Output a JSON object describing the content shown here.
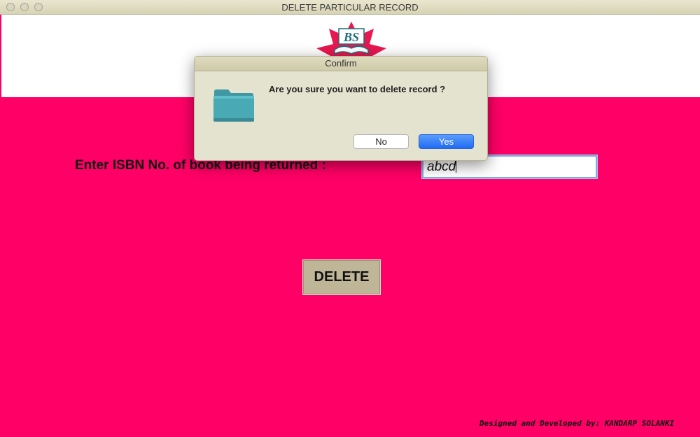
{
  "window": {
    "title": "DELETE PARTICULAR RECORD"
  },
  "header": {
    "logo_text": "BS"
  },
  "form": {
    "isbn_label": "Enter ISBN No. of book being returned :",
    "isbn_value": "abcd",
    "delete_label": "DELETE"
  },
  "footer": {
    "credit": "Designed and Developed by: KANDARP SOLANKI"
  },
  "dialog": {
    "title": "Confirm",
    "message": "Are you sure you want to delete record ?",
    "icon": "folder-icon",
    "no_label": "No",
    "yes_label": "Yes"
  },
  "colors": {
    "background": "#ff0066",
    "header": "#ffffff",
    "button": "#bfb597",
    "dialog": "#e4e3cf",
    "primary_button": "#1f6bf3",
    "logo": "#e8174f"
  }
}
